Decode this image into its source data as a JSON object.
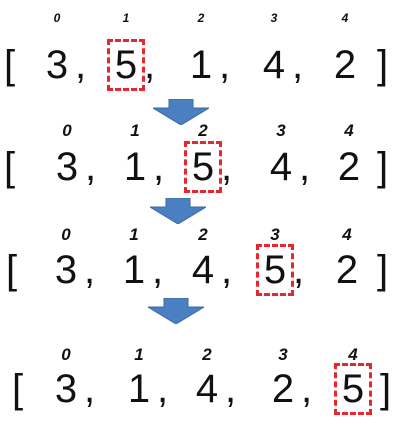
{
  "open_bracket": "[",
  "close_bracket": "]",
  "separator": ",",
  "arrow_color": "#4a7fc1",
  "highlight_color": "#e8262d",
  "rows": [
    {
      "indices": [
        "0",
        "1",
        "2",
        "3",
        "4"
      ],
      "values": [
        "3",
        "5",
        "1",
        "4",
        "2"
      ],
      "highlight_index": 1
    },
    {
      "indices": [
        "0",
        "1",
        "2",
        "3",
        "4"
      ],
      "values": [
        "3",
        "1",
        "5",
        "4",
        "2"
      ],
      "highlight_index": 2
    },
    {
      "indices": [
        "0",
        "1",
        "2",
        "3",
        "4"
      ],
      "values": [
        "3",
        "1",
        "4",
        "5",
        "2"
      ],
      "highlight_index": 3
    },
    {
      "indices": [
        "0",
        "1",
        "2",
        "3",
        "4"
      ],
      "values": [
        "3",
        "1",
        "4",
        "2",
        "5"
      ],
      "highlight_index": 4
    }
  ],
  "arrows": [
    {
      "name": "step-arrow-1"
    },
    {
      "name": "step-arrow-2"
    },
    {
      "name": "step-arrow-3"
    }
  ]
}
